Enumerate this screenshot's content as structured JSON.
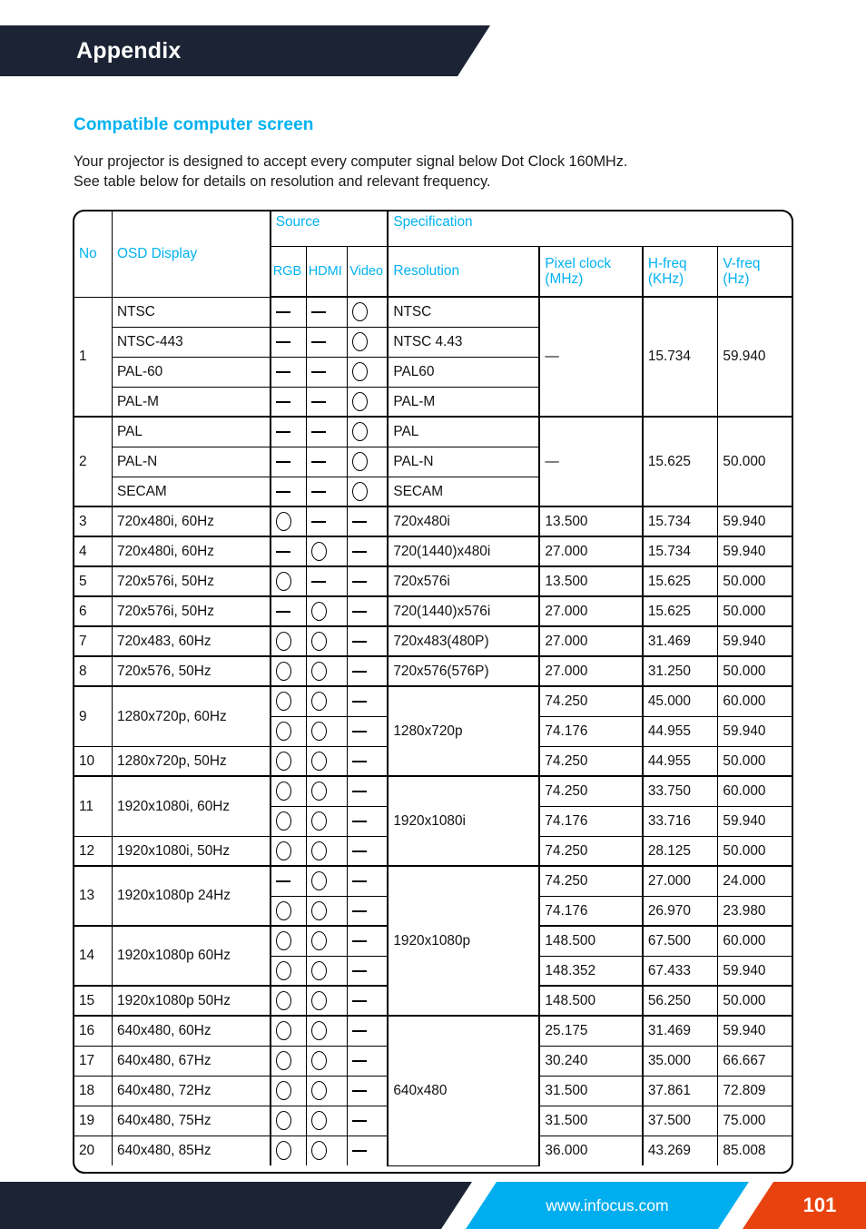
{
  "page": {
    "banner_title": "Appendix",
    "section_heading": "Compatible computer screen",
    "intro_line1": "Your projector is designed to accept every computer signal below Dot Clock 160MHz.",
    "intro_line2": "See table below for details on resolution and relevant frequency."
  },
  "colors": {
    "accent_blue": "#00b2f0",
    "dark_navy": "#1b2334",
    "footer_blue": "#00aeef",
    "footer_orange": "#e8430f"
  },
  "footer": {
    "website": "www.infocus.com",
    "page_number": "101"
  },
  "table": {
    "headers": {
      "no": "No",
      "osd_display": "OSD Display",
      "source": "Source",
      "specification": "Specification",
      "rgb": "RGB",
      "hdmi": "HDMI",
      "video": "Video",
      "resolution": "Resolution",
      "pixel_clock": "Pixel clock\n(MHz)",
      "pixel_clock_l1": "Pixel clock",
      "pixel_clock_l2": "(MHz)",
      "h_freq_l1": "H-freq",
      "h_freq_l2": "(KHz)",
      "v_freq_l1": "V-freq",
      "v_freq_l2": "(Hz)"
    },
    "symbols": {
      "supported": "circle",
      "not_supported": "dash"
    },
    "rows": [
      {
        "no": "1",
        "osd": "NTSC",
        "rgb": "dash",
        "hdmi": "dash",
        "video": "circle",
        "resolution": "NTSC",
        "pixel_clock": "—",
        "h_freq": "15.734",
        "v_freq": "59.940"
      },
      {
        "no": "",
        "osd": "NTSC-443",
        "rgb": "dash",
        "hdmi": "dash",
        "video": "circle",
        "resolution": "NTSC 4.43",
        "pixel_clock": "",
        "h_freq": "",
        "v_freq": ""
      },
      {
        "no": "",
        "osd": "PAL-60",
        "rgb": "dash",
        "hdmi": "dash",
        "video": "circle",
        "resolution": "PAL60",
        "pixel_clock": "",
        "h_freq": "",
        "v_freq": ""
      },
      {
        "no": "",
        "osd": "PAL-M",
        "rgb": "dash",
        "hdmi": "dash",
        "video": "circle",
        "resolution": "PAL-M",
        "pixel_clock": "",
        "h_freq": "",
        "v_freq": ""
      },
      {
        "no": "2",
        "osd": "PAL",
        "rgb": "dash",
        "hdmi": "dash",
        "video": "circle",
        "resolution": "PAL",
        "pixel_clock": "—",
        "h_freq": "15.625",
        "v_freq": "50.000"
      },
      {
        "no": "",
        "osd": "PAL-N",
        "rgb": "dash",
        "hdmi": "dash",
        "video": "circle",
        "resolution": "PAL-N",
        "pixel_clock": "",
        "h_freq": "",
        "v_freq": ""
      },
      {
        "no": "",
        "osd": "SECAM",
        "rgb": "dash",
        "hdmi": "dash",
        "video": "circle",
        "resolution": "SECAM",
        "pixel_clock": "",
        "h_freq": "",
        "v_freq": ""
      },
      {
        "no": "3",
        "osd": "720x480i, 60Hz",
        "rgb": "circle",
        "hdmi": "dash",
        "video": "dash",
        "resolution": "720x480i",
        "pixel_clock": "13.500",
        "h_freq": "15.734",
        "v_freq": "59.940"
      },
      {
        "no": "4",
        "osd": "720x480i, 60Hz",
        "rgb": "dash",
        "hdmi": "circle",
        "video": "dash",
        "resolution": "720(1440)x480i",
        "pixel_clock": "27.000",
        "h_freq": "15.734",
        "v_freq": "59.940"
      },
      {
        "no": "5",
        "osd": "720x576i, 50Hz",
        "rgb": "circle",
        "hdmi": "dash",
        "video": "dash",
        "resolution": "720x576i",
        "pixel_clock": "13.500",
        "h_freq": "15.625",
        "v_freq": "50.000"
      },
      {
        "no": "6",
        "osd": "720x576i, 50Hz",
        "rgb": "dash",
        "hdmi": "circle",
        "video": "dash",
        "resolution": "720(1440)x576i",
        "pixel_clock": "27.000",
        "h_freq": "15.625",
        "v_freq": "50.000"
      },
      {
        "no": "7",
        "osd": "720x483, 60Hz",
        "rgb": "circle",
        "hdmi": "circle",
        "video": "dash",
        "resolution": "720x483(480P)",
        "pixel_clock": "27.000",
        "h_freq": "31.469",
        "v_freq": "59.940"
      },
      {
        "no": "8",
        "osd": "720x576, 50Hz",
        "rgb": "circle",
        "hdmi": "circle",
        "video": "dash",
        "resolution": "720x576(576P)",
        "pixel_clock": "27.000",
        "h_freq": "31.250",
        "v_freq": "50.000"
      },
      {
        "no": "9",
        "osd": "1280x720p, 60Hz",
        "rgb": "circle",
        "hdmi": "circle",
        "video": "dash",
        "resolution": "1280x720p",
        "pixel_clock": "74.250",
        "h_freq": "45.000",
        "v_freq": "60.000"
      },
      {
        "no": "",
        "osd": "",
        "rgb": "circle",
        "hdmi": "circle",
        "video": "dash",
        "resolution": "",
        "pixel_clock": "74.176",
        "h_freq": "44.955",
        "v_freq": "59.940"
      },
      {
        "no": "10",
        "osd": "1280x720p, 50Hz",
        "rgb": "circle",
        "hdmi": "circle",
        "video": "dash",
        "resolution": "",
        "pixel_clock": "74.250",
        "h_freq": "44.955",
        "v_freq": "50.000"
      },
      {
        "no": "11",
        "osd": "1920x1080i, 60Hz",
        "rgb": "circle",
        "hdmi": "circle",
        "video": "dash",
        "resolution": "1920x1080i",
        "pixel_clock": "74.250",
        "h_freq": "33.750",
        "v_freq": "60.000"
      },
      {
        "no": "",
        "osd": "",
        "rgb": "circle",
        "hdmi": "circle",
        "video": "dash",
        "resolution": "",
        "pixel_clock": "74.176",
        "h_freq": "33.716",
        "v_freq": "59.940"
      },
      {
        "no": "12",
        "osd": "1920x1080i, 50Hz",
        "rgb": "circle",
        "hdmi": "circle",
        "video": "dash",
        "resolution": "",
        "pixel_clock": "74.250",
        "h_freq": "28.125",
        "v_freq": "50.000"
      },
      {
        "no": "13",
        "osd": "1920x1080p 24Hz",
        "rgb": "dash",
        "hdmi": "circle",
        "video": "dash",
        "resolution": "1920x1080p",
        "pixel_clock": "74.250",
        "h_freq": "27.000",
        "v_freq": "24.000"
      },
      {
        "no": "",
        "osd": "",
        "rgb": "circle",
        "hdmi": "circle",
        "video": "dash",
        "resolution": "",
        "pixel_clock": "74.176",
        "h_freq": "26.970",
        "v_freq": "23.980"
      },
      {
        "no": "14",
        "osd": "1920x1080p 60Hz",
        "rgb": "circle",
        "hdmi": "circle",
        "video": "dash",
        "resolution": "",
        "pixel_clock": "148.500",
        "h_freq": "67.500",
        "v_freq": "60.000"
      },
      {
        "no": "",
        "osd": "",
        "rgb": "circle",
        "hdmi": "circle",
        "video": "dash",
        "resolution": "",
        "pixel_clock": "148.352",
        "h_freq": "67.433",
        "v_freq": "59.940"
      },
      {
        "no": "15",
        "osd": "1920x1080p 50Hz",
        "rgb": "circle",
        "hdmi": "circle",
        "video": "dash",
        "resolution": "",
        "pixel_clock": "148.500",
        "h_freq": "56.250",
        "v_freq": "50.000"
      },
      {
        "no": "16",
        "osd": "640x480, 60Hz",
        "rgb": "circle",
        "hdmi": "circle",
        "video": "dash",
        "resolution": "640x480",
        "pixel_clock": "25.175",
        "h_freq": "31.469",
        "v_freq": "59.940"
      },
      {
        "no": "17",
        "osd": "640x480, 67Hz",
        "rgb": "circle",
        "hdmi": "circle",
        "video": "dash",
        "resolution": "",
        "pixel_clock": "30.240",
        "h_freq": "35.000",
        "v_freq": "66.667"
      },
      {
        "no": "18",
        "osd": "640x480, 72Hz",
        "rgb": "circle",
        "hdmi": "circle",
        "video": "dash",
        "resolution": "",
        "pixel_clock": "31.500",
        "h_freq": "37.861",
        "v_freq": "72.809"
      },
      {
        "no": "19",
        "osd": "640x480, 75Hz",
        "rgb": "circle",
        "hdmi": "circle",
        "video": "dash",
        "resolution": "",
        "pixel_clock": "31.500",
        "h_freq": "37.500",
        "v_freq": "75.000"
      },
      {
        "no": "20",
        "osd": "640x480, 85Hz",
        "rgb": "circle",
        "hdmi": "circle",
        "video": "dash",
        "resolution": "",
        "pixel_clock": "36.000",
        "h_freq": "43.269",
        "v_freq": "85.008"
      }
    ]
  }
}
